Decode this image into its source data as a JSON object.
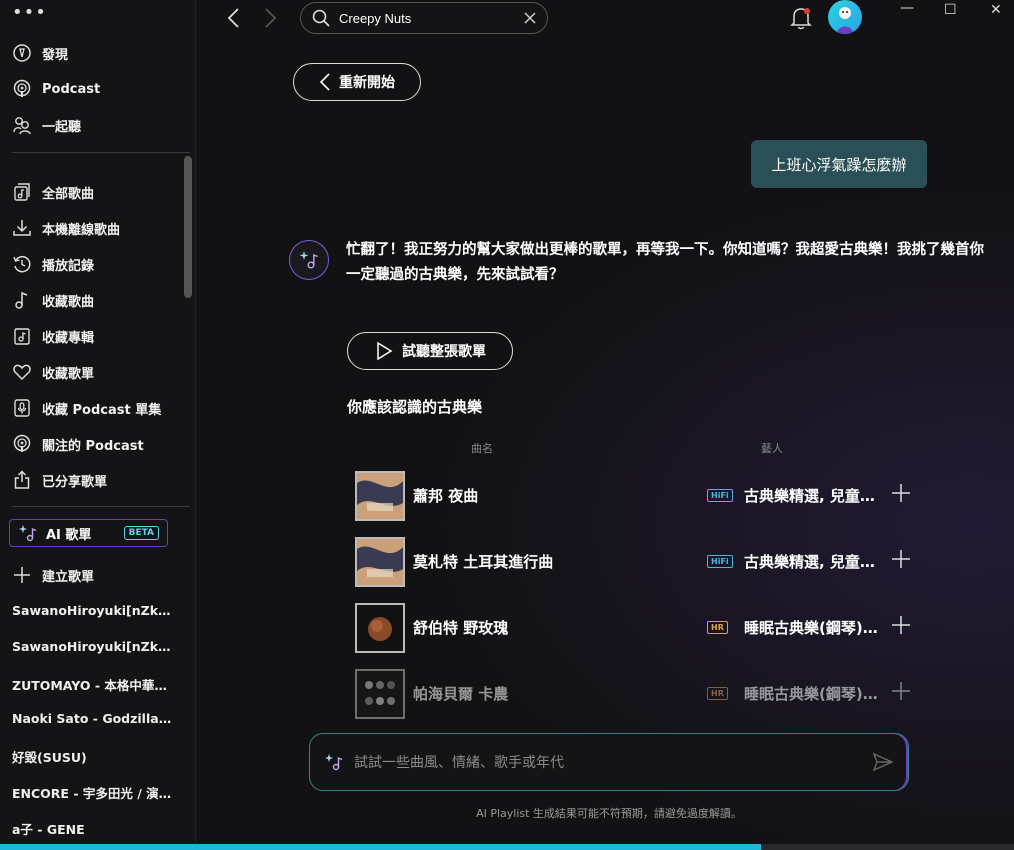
{
  "sidebar": {
    "menu_icon": "more-icon",
    "primary": [
      {
        "label": "發現",
        "icon": "compass-icon"
      },
      {
        "label": "Podcast",
        "icon": "podcast-icon"
      },
      {
        "label": "一起聽",
        "icon": "group-listen-icon"
      }
    ],
    "library": [
      {
        "label": "全部歌曲",
        "icon": "all-songs-icon"
      },
      {
        "label": "本機離線歌曲",
        "icon": "download-icon"
      },
      {
        "label": "播放記錄",
        "icon": "history-icon"
      },
      {
        "label": "收藏歌曲",
        "icon": "music-note-icon"
      },
      {
        "label": "收藏專輯",
        "icon": "album-icon"
      },
      {
        "label": "收藏歌單",
        "icon": "heart-icon"
      },
      {
        "label": "收藏 Podcast 單集",
        "icon": "mic-icon"
      },
      {
        "label": "關注的 Podcast",
        "icon": "podcast-icon"
      },
      {
        "label": "已分享歌單",
        "icon": "share-icon"
      }
    ],
    "ai_playlist": {
      "label": "AI 歌單",
      "badge": "BETA"
    },
    "create_playlist": "建立歌單",
    "playlists": [
      "SawanoHiroyuki[nZk],…",
      "SawanoHiroyuki[nZk],…",
      "ZUTOMAYO - 本格中華…",
      "Naoki Sato - Godzilla …",
      "好毀(SUSU)",
      "ENCORE - 宇多田光 / 演…",
      "a子 - GENE"
    ]
  },
  "topbar": {
    "search_value": "Creepy Nuts",
    "window_controls": [
      "—",
      "☐",
      "✕"
    ]
  },
  "chat": {
    "restart_label": "重新開始",
    "user_message": "上班心浮氣躁怎麼辦",
    "ai_message": "忙翻了！我正努力的幫大家做出更棒的歌單，再等我一下。你知道嗎？我超愛古典樂！我挑了幾首你一定聽過的古典樂，先來試試看？",
    "play_all_label": "試聽整張歌單",
    "playlist_title": "你應該認識的古典樂",
    "col_title": "曲名",
    "col_artist": "藝人",
    "tracks": [
      {
        "title": "蕭邦 夜曲",
        "quality": "HiFi",
        "artist": "古典樂精選, 兒童…"
      },
      {
        "title": "莫札特 土耳其進行曲",
        "quality": "HiFi",
        "artist": "古典樂精選, 兒童…"
      },
      {
        "title": "舒伯特 野玫瑰",
        "quality": "HR",
        "artist": "睡眠古典樂(鋼琴)…"
      },
      {
        "title": "帕海貝爾 卡農",
        "quality": "HR",
        "artist": "睡眠古典樂(鋼琴)…"
      }
    ],
    "prompt_placeholder": "試試一些曲風、情緒、歌手或年代",
    "disclaimer": "AI Playlist 生成結果可能不符預期，請避免過度解讀。"
  },
  "player": {
    "progress_percent": 75
  },
  "colors": {
    "accent": "#1fb8d6",
    "ai_purple": "#6b3fb5",
    "user_bubble": "#2b4f57"
  }
}
